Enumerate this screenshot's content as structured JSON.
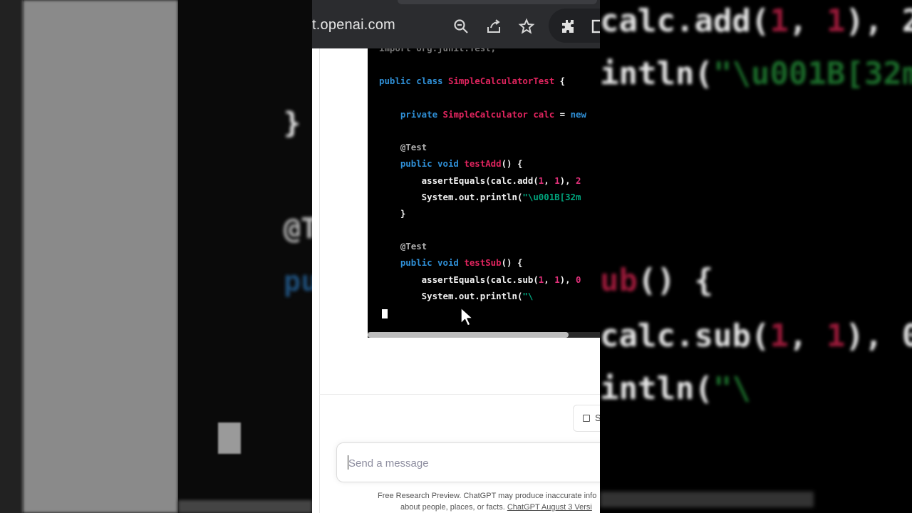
{
  "browser": {
    "url": "t.openai.com"
  },
  "code": {
    "lines": [
      [
        {
          "t": "import org.junit.Test;",
          "c": "dim"
        }
      ],
      [],
      [
        {
          "t": "public class ",
          "c": "kw"
        },
        {
          "t": "SimpleCalculatorTest",
          "c": "cls"
        },
        {
          "t": " {",
          "c": "plain"
        }
      ],
      [],
      [
        {
          "t": "    private ",
          "c": "kw"
        },
        {
          "t": "SimpleCalculator calc",
          "c": "cls"
        },
        {
          "t": " = ",
          "c": "plain"
        },
        {
          "t": "new",
          "c": "kw"
        }
      ],
      [],
      [
        {
          "t": "    @Test",
          "c": "ann"
        }
      ],
      [
        {
          "t": "    public void ",
          "c": "kw"
        },
        {
          "t": "testAdd",
          "c": "cls"
        },
        {
          "t": "() {",
          "c": "plain"
        }
      ],
      [
        {
          "t": "        assertEquals(calc.add(",
          "c": "plain"
        },
        {
          "t": "1",
          "c": "num"
        },
        {
          "t": ", ",
          "c": "plain"
        },
        {
          "t": "1",
          "c": "num"
        },
        {
          "t": "), ",
          "c": "plain"
        },
        {
          "t": "2",
          "c": "num"
        }
      ],
      [
        {
          "t": "        System.out.println(",
          "c": "plain"
        },
        {
          "t": "\"\\u001B[32m",
          "c": "str"
        }
      ],
      [
        {
          "t": "    }",
          "c": "plain"
        }
      ],
      [],
      [
        {
          "t": "    @Test",
          "c": "ann"
        }
      ],
      [
        {
          "t": "    public void ",
          "c": "kw"
        },
        {
          "t": "testSub",
          "c": "cls"
        },
        {
          "t": "() {",
          "c": "plain"
        }
      ],
      [
        {
          "t": "        assertEquals(calc.sub(",
          "c": "plain"
        },
        {
          "t": "1",
          "c": "num"
        },
        {
          "t": ", ",
          "c": "plain"
        },
        {
          "t": "1",
          "c": "num"
        },
        {
          "t": "), ",
          "c": "plain"
        },
        {
          "t": "0",
          "c": "num"
        }
      ],
      [
        {
          "t": "        System.out.println(",
          "c": "plain"
        },
        {
          "t": "\"\\",
          "c": "str"
        }
      ]
    ]
  },
  "background": {
    "left_lines": [
      "}",
      "@T",
      "pu"
    ],
    "right_lines": [
      {
        "parts": [
          {
            "t": "calc.add(",
            "c": "white"
          },
          {
            "t": "1",
            "c": "red"
          },
          {
            "t": ", ",
            "c": "white"
          },
          {
            "t": "1",
            "c": "red"
          },
          {
            "t": "), 2",
            "c": "white"
          }
        ]
      },
      {
        "parts": [
          {
            "t": "intln(",
            "c": "white"
          },
          {
            "t": "\"\\u001B[32m",
            "c": "green"
          }
        ]
      },
      {
        "parts": [
          {
            "t": "ub",
            "c": "red"
          },
          {
            "t": "() {",
            "c": "white"
          }
        ]
      },
      {
        "parts": [
          {
            "t": "calc.sub(",
            "c": "white"
          },
          {
            "t": "1",
            "c": "red"
          },
          {
            "t": ", ",
            "c": "white"
          },
          {
            "t": "1",
            "c": "red"
          },
          {
            "t": "), 0",
            "c": "white"
          }
        ]
      },
      {
        "parts": [
          {
            "t": "intln(",
            "c": "white"
          },
          {
            "t": "\"\\",
            "c": "green"
          }
        ]
      }
    ]
  },
  "stop_button": {
    "label": "S"
  },
  "composer": {
    "placeholder": "Send a message"
  },
  "footer": {
    "line1": "Free Research Preview. ChatGPT may produce inaccurate info",
    "line2_prefix": "about people, places, or facts. ",
    "line2_link": "ChatGPT August 3 Versi"
  },
  "colors": {
    "keyword": "#2f8fd6",
    "class_name": "#e0245e",
    "string": "#00a67e",
    "number": "#df3079",
    "chrome_bar": "#2b2c2f"
  }
}
